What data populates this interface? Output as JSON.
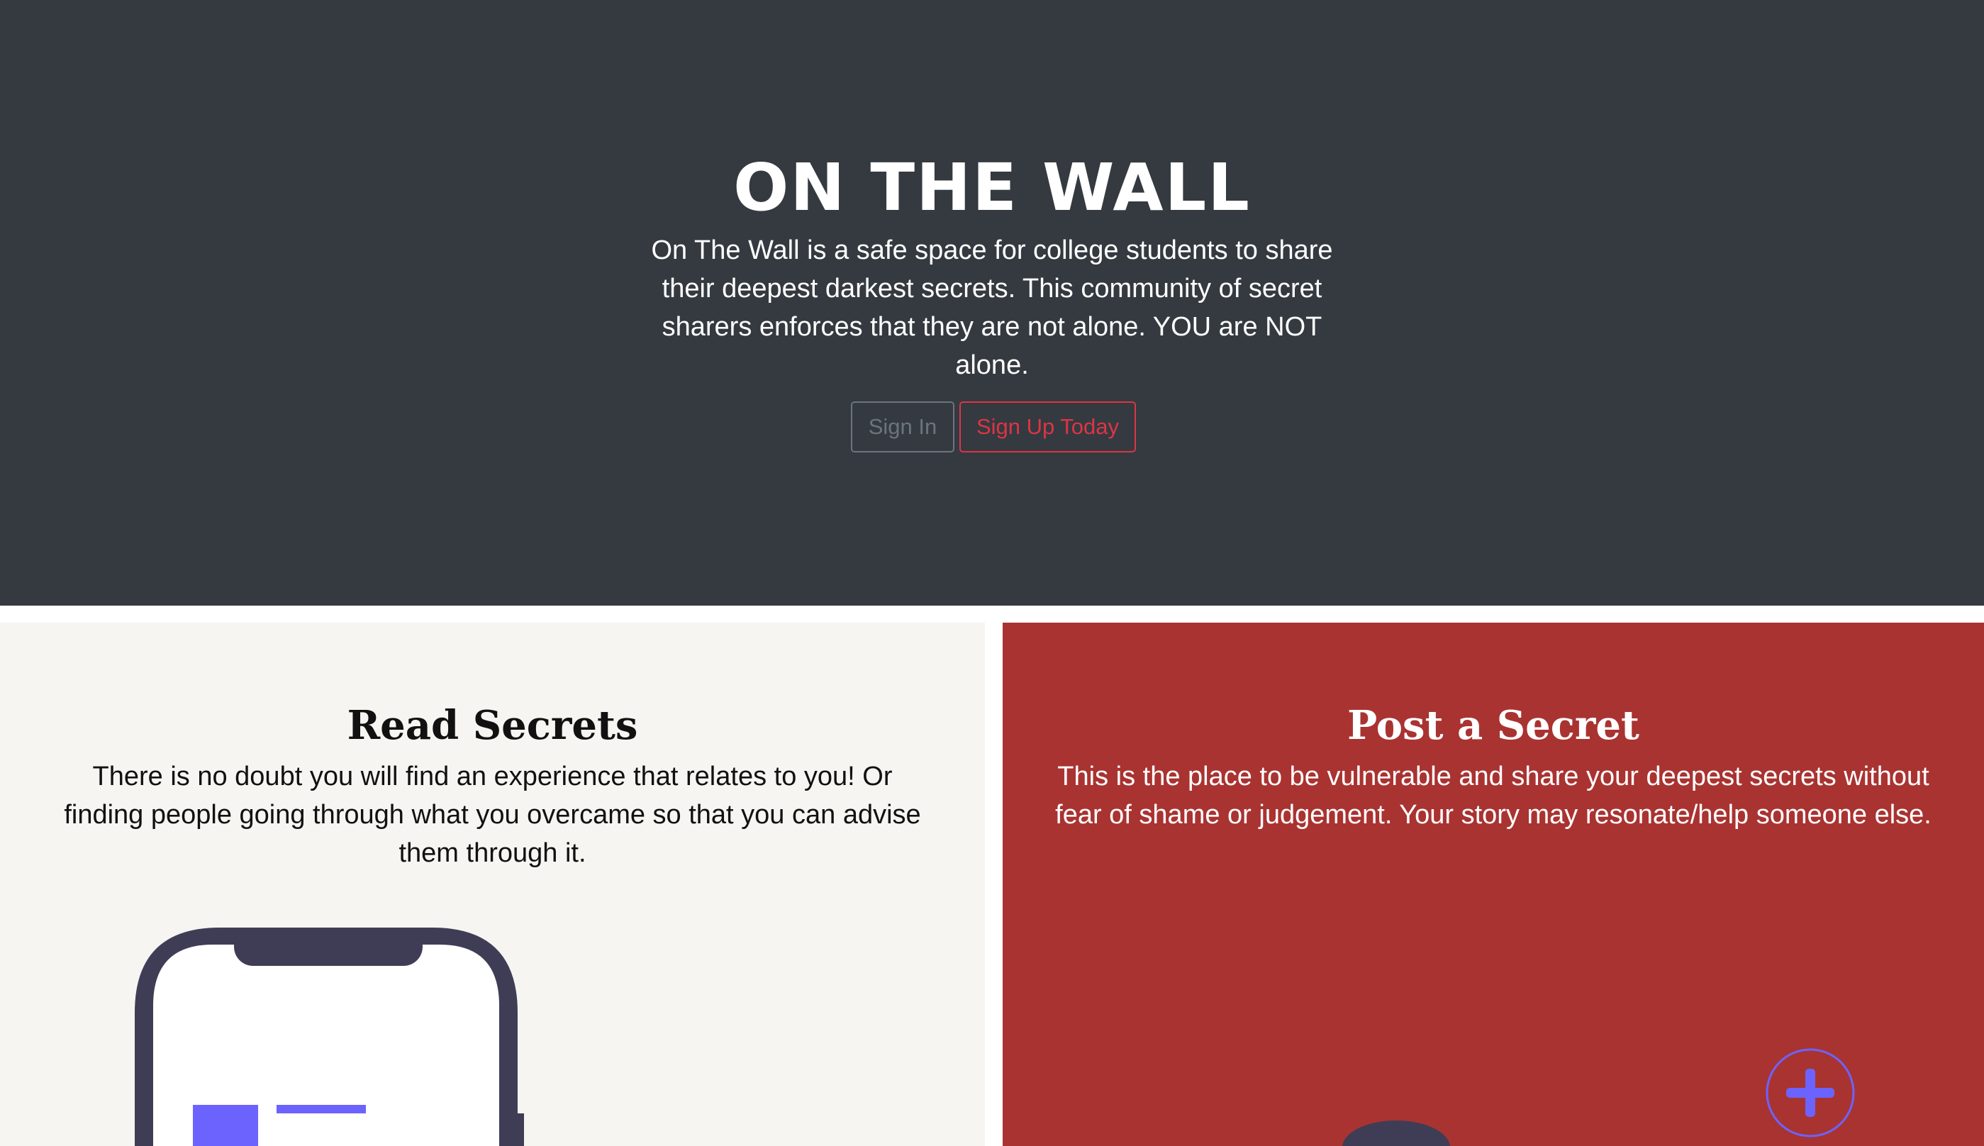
{
  "hero": {
    "title": "ON THE WALL",
    "description": "On The Wall is a safe space for college students to share their deepest darkest secrets. This community of secret sharers enforces that they are not alone. YOU are NOT alone.",
    "sign_in_label": "Sign In",
    "sign_up_label": "Sign Up Today",
    "background": "#343a40"
  },
  "read": {
    "title": "Read Secrets",
    "description": "There is no doubt you will find an experience that relates to you! Or finding people going through what you overcame so that you can advise them through it.",
    "illustration": "phone-illustration",
    "background": "#f6f5f1"
  },
  "post": {
    "title": "Post a Secret",
    "description": "This is the place to be vulnerable and share your deepest secrets without fear of shame or judgement. Your story may resonate/help someone else.",
    "illustration": "plus-circle-icon",
    "background": "#a93331"
  },
  "colors": {
    "accent_purple": "#6c63ff",
    "illustration_dark": "#3f3d56",
    "danger": "#dc3545",
    "secondary": "#6c757d"
  }
}
